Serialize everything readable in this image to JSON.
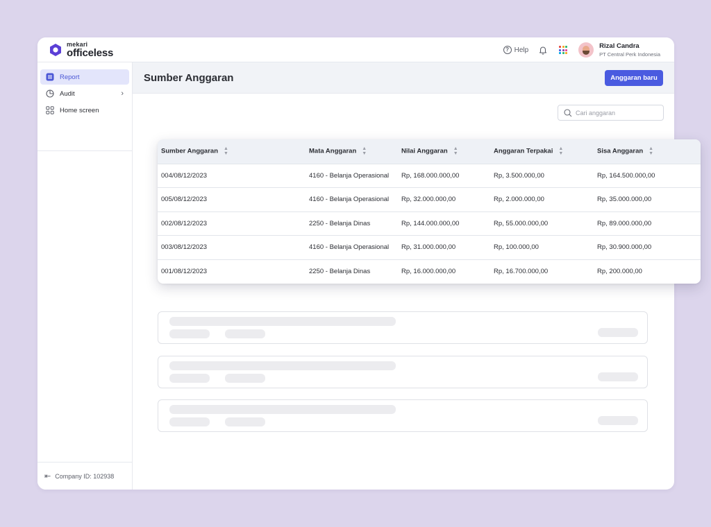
{
  "brand": {
    "small": "mekari",
    "big": "officeless",
    "color": "#5b3fd6"
  },
  "header": {
    "help_label": "Help",
    "user_name": "Rizal Candra",
    "user_company": "PT Central Perk Indonesia"
  },
  "sidebar": {
    "items": [
      {
        "label": "Report",
        "icon": "list-icon",
        "active": true
      },
      {
        "label": "Audit",
        "icon": "pie-chart-icon",
        "active": false
      },
      {
        "label": "Home screen",
        "icon": "grid-icon",
        "active": false
      }
    ],
    "company_id": "Company ID: 102938"
  },
  "page": {
    "title": "Sumber Anggaran",
    "new_button": "Anggaran baru",
    "search_placeholder": "Cari anggaran",
    "accent": "#4a5be0"
  },
  "table": {
    "columns": [
      "Sumber Anggaran",
      "Mata Anggaran",
      "Nilai Anggaran",
      "Anggaran Terpakai",
      "Sisa Anggaran"
    ],
    "rows": [
      [
        "004/08/12/2023",
        "4160 - Belanja Operasional",
        "Rp, 168.000.000,00",
        "Rp, 3.500.000,00",
        "Rp, 164.500.000,00"
      ],
      [
        "005/08/12/2023",
        "4160 - Belanja Operasional",
        "Rp, 32.000.000,00",
        "Rp, 2.000.000,00",
        "Rp, 35.000.000,00"
      ],
      [
        "002/08/12/2023",
        "2250 - Belanja Dinas",
        "Rp, 144.000.000,00",
        "Rp, 55.000.000,00",
        "Rp, 89.000.000,00"
      ],
      [
        "003/08/12/2023",
        "4160 - Belanja Operasional",
        "Rp, 31.000.000,00",
        "Rp, 100.000,00",
        "Rp, 30.900.000,00"
      ],
      [
        "001/08/12/2023",
        "2250 - Belanja Dinas",
        "Rp, 16.000.000,00",
        "Rp, 16.700.000,00",
        "Rp, 200.000,00"
      ]
    ]
  }
}
